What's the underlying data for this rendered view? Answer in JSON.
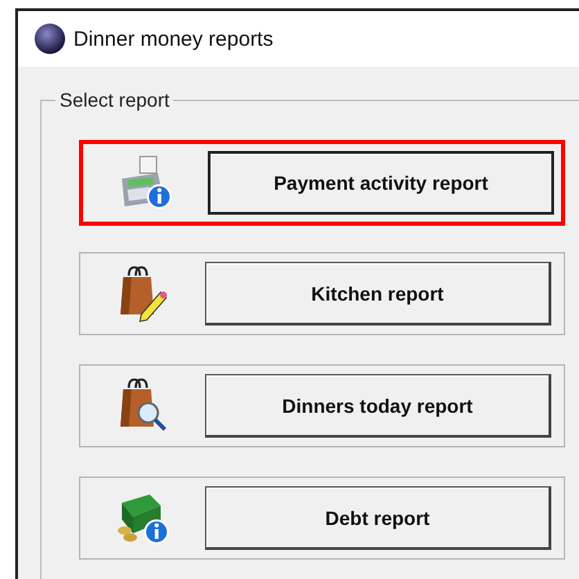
{
  "window": {
    "title": "Dinner money reports"
  },
  "group": {
    "label": "Select report"
  },
  "reports": [
    {
      "kind": "register-info",
      "label": "Payment activity report",
      "highlighted": true
    },
    {
      "kind": "bag-pencil",
      "label": "Kitchen report",
      "highlighted": false
    },
    {
      "kind": "bag-search",
      "label": "Dinners today report",
      "highlighted": false
    },
    {
      "kind": "cash-info",
      "label": "Debt report",
      "highlighted": false
    }
  ]
}
